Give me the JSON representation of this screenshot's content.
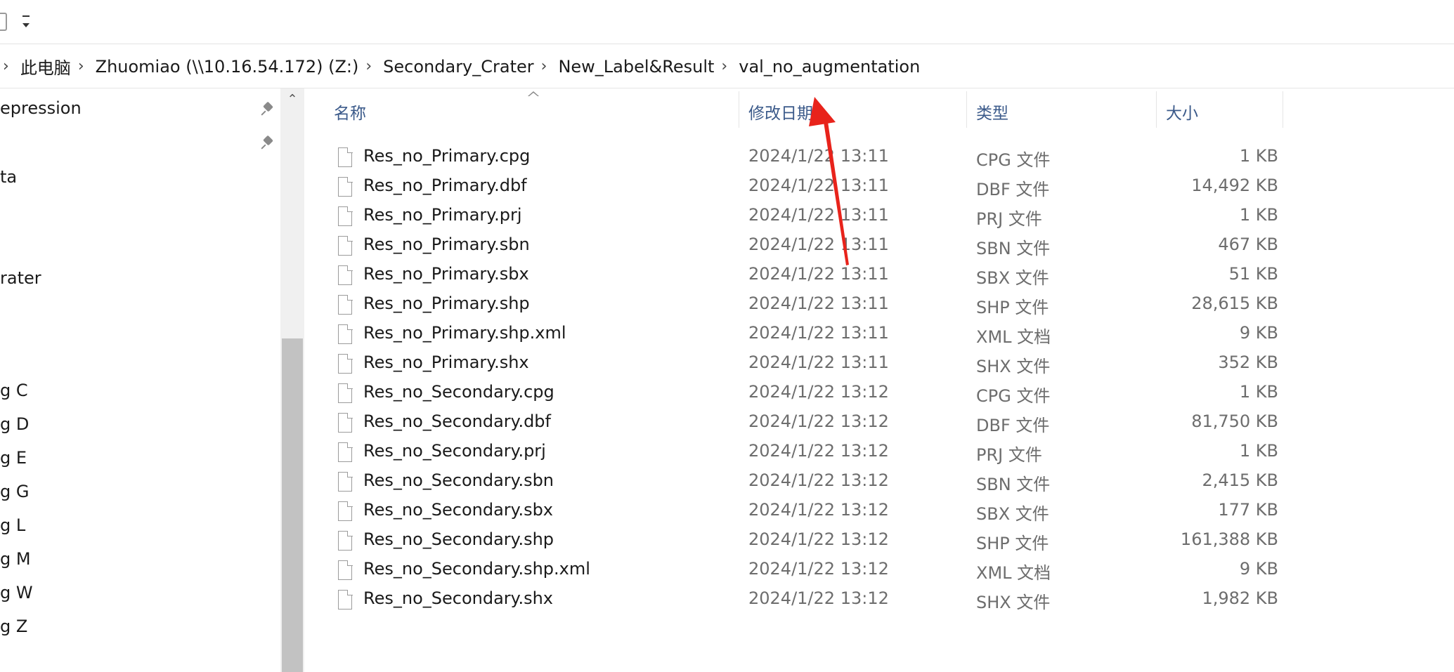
{
  "breadcrumb": [
    "此电脑",
    "Zhuomiao (\\\\10.16.54.172) (Z:)",
    "Secondary_Crater",
    "New_Label&Result",
    "val_no_augmentation"
  ],
  "nav_items": [
    "epression",
    "ta",
    "rater",
    "g C",
    "g D",
    "g E",
    "g G",
    "g L",
    "g M",
    "g W",
    "g Z"
  ],
  "columns": {
    "name": "名称",
    "date": "修改日期",
    "type": "类型",
    "size": "大小"
  },
  "files": [
    {
      "name": "Res_no_Primary.cpg",
      "date": "2024/1/22 13:11",
      "type": "CPG 文件",
      "size": "1 KB"
    },
    {
      "name": "Res_no_Primary.dbf",
      "date": "2024/1/22 13:11",
      "type": "DBF 文件",
      "size": "14,492 KB"
    },
    {
      "name": "Res_no_Primary.prj",
      "date": "2024/1/22 13:11",
      "type": "PRJ 文件",
      "size": "1 KB"
    },
    {
      "name": "Res_no_Primary.sbn",
      "date": "2024/1/22 13:11",
      "type": "SBN 文件",
      "size": "467 KB"
    },
    {
      "name": "Res_no_Primary.sbx",
      "date": "2024/1/22 13:11",
      "type": "SBX 文件",
      "size": "51 KB"
    },
    {
      "name": "Res_no_Primary.shp",
      "date": "2024/1/22 13:11",
      "type": "SHP 文件",
      "size": "28,615 KB"
    },
    {
      "name": "Res_no_Primary.shp.xml",
      "date": "2024/1/22 13:11",
      "type": "XML 文档",
      "size": "9 KB"
    },
    {
      "name": "Res_no_Primary.shx",
      "date": "2024/1/22 13:11",
      "type": "SHX 文件",
      "size": "352 KB"
    },
    {
      "name": "Res_no_Secondary.cpg",
      "date": "2024/1/22 13:12",
      "type": "CPG 文件",
      "size": "1 KB"
    },
    {
      "name": "Res_no_Secondary.dbf",
      "date": "2024/1/22 13:12",
      "type": "DBF 文件",
      "size": "81,750 KB"
    },
    {
      "name": "Res_no_Secondary.prj",
      "date": "2024/1/22 13:12",
      "type": "PRJ 文件",
      "size": "1 KB"
    },
    {
      "name": "Res_no_Secondary.sbn",
      "date": "2024/1/22 13:12",
      "type": "SBN 文件",
      "size": "2,415 KB"
    },
    {
      "name": "Res_no_Secondary.sbx",
      "date": "2024/1/22 13:12",
      "type": "SBX 文件",
      "size": "177 KB"
    },
    {
      "name": "Res_no_Secondary.shp",
      "date": "2024/1/22 13:12",
      "type": "SHP 文件",
      "size": "161,388 KB"
    },
    {
      "name": "Res_no_Secondary.shp.xml",
      "date": "2024/1/22 13:12",
      "type": "XML 文档",
      "size": "9 KB"
    },
    {
      "name": "Res_no_Secondary.shx",
      "date": "2024/1/22 13:12",
      "type": "SHX 文件",
      "size": "1,982 KB"
    }
  ],
  "colors": {
    "header_text": "#3b5a8a",
    "secondary_text": "#6d6d6d",
    "annotation": "#e8231b"
  },
  "icons": [
    "quick-access-icon",
    "chevron-right-icon",
    "pin-icon",
    "file-icon",
    "sort-caret-icon",
    "scroll-up-icon"
  ]
}
